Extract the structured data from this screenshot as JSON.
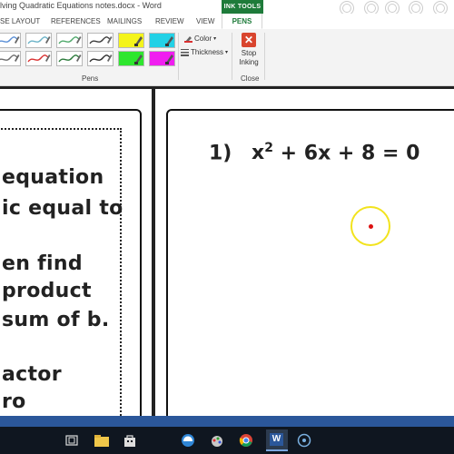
{
  "window": {
    "title": "lving Quadratic Equations notes.docx - Word",
    "contextual_tab": "INK TOOLS"
  },
  "ribbon_tabs": [
    "SE LAYOUT",
    "REFERENCES",
    "MAILINGS",
    "REVIEW",
    "VIEW"
  ],
  "active_tab": "PENS",
  "pens_group": {
    "label": "Pens",
    "pens": [
      {
        "color": "#5a8fd6",
        "kind": "pen"
      },
      {
        "color": "#6bb3c8",
        "kind": "pen"
      },
      {
        "color": "#4fa96b",
        "kind": "pen"
      },
      {
        "color": "#3c3c3c",
        "kind": "pen"
      },
      {
        "color": "#f4f41a",
        "kind": "highlighter"
      },
      {
        "color": "#22d1e6",
        "kind": "highlighter"
      },
      {
        "color": "#6e6e6e",
        "kind": "pen"
      },
      {
        "color": "#d93030",
        "kind": "pen"
      },
      {
        "color": "#2a7a3a",
        "kind": "pen"
      },
      {
        "color": "#2c2c2c",
        "kind": "pen"
      },
      {
        "color": "#2ee62e",
        "kind": "highlighter"
      },
      {
        "color": "#f01ef0",
        "kind": "highlighter"
      }
    ],
    "color_label": "Color",
    "thickness_label": "Thickness"
  },
  "close_group": {
    "stop_inking_line1": "Stop",
    "stop_inking_line2": "Inking",
    "label": "Close",
    "stop_icon": "close-x-icon"
  },
  "document": {
    "left_lines": [
      "equation",
      "ic equal to",
      "en find",
      "product",
      "sum of b.",
      "actor",
      "ro"
    ],
    "equation": {
      "number": "1)",
      "lhs": "x",
      "exponent": "2",
      "rest": "+ 6x + 8 = 0"
    }
  },
  "colors": {
    "ink_tools_green": "#1e7b3a",
    "status_blue": "#2b579a",
    "taskbar_dark": "#0f1620",
    "cursor_ring": "#f2e31d",
    "cursor_dot": "#dd1111"
  },
  "taskbar": {
    "icons": [
      "task-view-icon",
      "file-explorer-icon",
      "store-icon",
      "edge-icon",
      "paint-icon",
      "chrome-icon",
      "word-icon",
      "media-icon"
    ]
  }
}
